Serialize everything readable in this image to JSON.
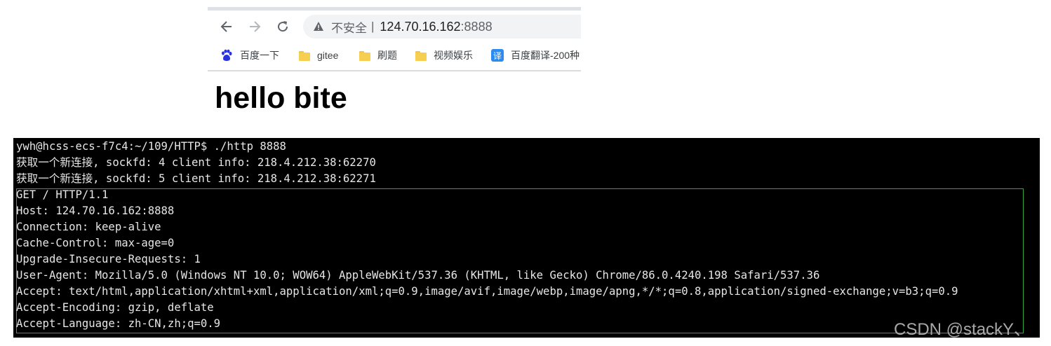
{
  "browser": {
    "security_label": "不安全",
    "separator": "|",
    "url_host": "124.70.16.162",
    "url_port": ":8888",
    "bookmarks": [
      {
        "label": "百度一下",
        "icon": "baidu-paw-icon"
      },
      {
        "label": "gitee",
        "icon": "folder-icon"
      },
      {
        "label": "刷题",
        "icon": "folder-icon"
      },
      {
        "label": "视频娱乐",
        "icon": "folder-icon"
      },
      {
        "label": "百度翻译-200种",
        "icon": "translate-icon"
      }
    ],
    "translate_icon_char": "译"
  },
  "page": {
    "heading": "hello bite"
  },
  "terminal": {
    "prompt_line": "ywh@hcss-ecs-f7c4:~/109/HTTP$ ./http 8888",
    "log_lines": [
      "获取一个新连接, sockfd: 4 client info: 218.4.212.38:62270",
      "获取一个新连接, sockfd: 5 client info: 218.4.212.38:62271"
    ],
    "request_lines": [
      "GET / HTTP/1.1",
      "Host: 124.70.16.162:8888",
      "Connection: keep-alive",
      "Cache-Control: max-age=0",
      "Upgrade-Insecure-Requests: 1",
      "User-Agent: Mozilla/5.0 (Windows NT 10.0; WOW64) AppleWebKit/537.36 (KHTML, like Gecko) Chrome/86.0.4240.198 Safari/537.36",
      "Accept: text/html,application/xhtml+xml,application/xml;q=0.9,image/avif,image/webp,image/apng,*/*;q=0.8,application/signed-exchange;v=b3;q=0.9",
      "Accept-Encoding: gzip, deflate",
      "Accept-Language: zh-CN,zh;q=0.9"
    ],
    "highlight_color": "#2faa3a"
  },
  "watermark": "CSDN @stackY、"
}
